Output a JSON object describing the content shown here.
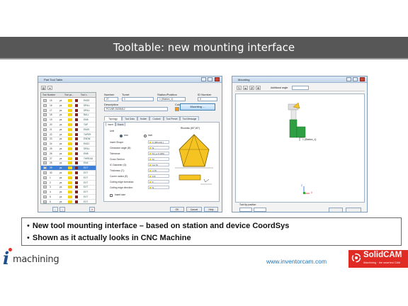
{
  "slide": {
    "title": "Tooltable: new mounting interface",
    "bullets": [
      "New tool mounting interface – based on station and device CoordSys",
      "Shown as it actually looks in CNC Machine"
    ],
    "website": "www.inventorcam.com",
    "logos": {
      "imachining_small": " ",
      "imachining_word": "machining",
      "imachining_i": "i",
      "solidcam": "SolidCAM",
      "solidcam_tagline": "iMachining · the smartest CAM"
    }
  },
  "colors": {
    "title_bar": "#575757",
    "accent_red": "#e02b25",
    "link_blue": "#1d73b7",
    "tool_yellow": "#f5d400",
    "mount_green": "#2ea043"
  },
  "tool_table_window": {
    "title": "Part Tool Table",
    "grid_headers": [
      "Tool Number",
      "Tool po...",
      "Tool t..."
    ],
    "rows": [
      {
        "num": "15",
        "pos": "ps",
        "type": "EM15",
        "sel": false
      },
      {
        "num": "16",
        "pos": "ps",
        "type": "DRILL",
        "sel": false
      },
      {
        "num": "17",
        "pos": "ps",
        "type": "DRILL",
        "sel": false
      },
      {
        "num": "18",
        "pos": "ps",
        "type": "BALL",
        "sel": false
      },
      {
        "num": "19",
        "pos": "ps",
        "type": "EM6",
        "sel": false
      },
      {
        "num": "20",
        "pos": "ps",
        "type": "TAP",
        "sel": false
      },
      {
        "num": "21",
        "pos": "ps",
        "type": "EM20",
        "sel": false
      },
      {
        "num": "22",
        "pos": "ps",
        "type": "TAPER",
        "sel": false
      },
      {
        "num": "23",
        "pos": "ps",
        "type": "ENDM",
        "sel": false
      },
      {
        "num": "24",
        "pos": "ps",
        "type": "EM12",
        "sel": false
      },
      {
        "num": "25",
        "pos": "ps",
        "type": "DRILL",
        "sel": false
      },
      {
        "num": "26",
        "pos": "ps",
        "type": "EM8",
        "sel": false
      },
      {
        "num": "27",
        "pos": "ps",
        "type": "THREAD",
        "sel": false
      },
      {
        "num": "28",
        "pos": "ps",
        "type": "EM4",
        "sel": false
      },
      {
        "num": "29",
        "pos": "ps",
        "type": "EXT",
        "sel": true
      },
      {
        "num": "30",
        "pos": "ps",
        "type": "EXT",
        "sel": false
      },
      {
        "num": "1",
        "pos": "ps",
        "type": "EXT",
        "sel": false
      },
      {
        "num": "2",
        "pos": "ps",
        "type": "EXT",
        "sel": false
      },
      {
        "num": "3",
        "pos": "ps",
        "type": "EXT",
        "sel": false
      },
      {
        "num": "4",
        "pos": "ps",
        "type": "EXT",
        "sel": false
      },
      {
        "num": "5",
        "pos": "ps",
        "type": "EXT",
        "sel": false
      },
      {
        "num": "6",
        "pos": "ps",
        "type": "EXT",
        "sel": false
      }
    ],
    "group_label": "MULTITURRET",
    "labels": {
      "number": "Number",
      "turret": "Turret",
      "station": "Station/Position",
      "id": "ID Number",
      "description": "Description",
      "color": "Color",
      "mounting": "Mounting ..."
    },
    "values": {
      "number": "27",
      "turret": "1",
      "station": "1 (Station_1)",
      "id": "0",
      "description": "PCLNR 2525M12"
    },
    "tabs": [
      "Topology",
      "Tool Data",
      "Holder",
      "Coolant",
      "Tool Preset",
      "Tool Message"
    ],
    "subtabs": [
      "Insert",
      "Shank"
    ],
    "unit_label": "Unit",
    "units": [
      "mm",
      "inch"
    ],
    "preview_title": "Rhombic (80°,80°)",
    "params": [
      {
        "label": "Insert Shape:",
        "value": "C (Rhomb.)"
      },
      {
        "label": "Clearance angle (B):",
        "value": "N"
      },
      {
        "label": "Tolerance:",
        "value": "M (+/-0.025)"
      },
      {
        "label": "Cross Section:",
        "value": "M"
      },
      {
        "label": "IC Diameter (G):",
        "value": "12.70"
      },
      {
        "label": "Thickness (T):",
        "value": "4.76"
      },
      {
        "label": "Corner radius (E):",
        "value": "0.8"
      },
      {
        "label": "Cutting edge formation:",
        "value": "F"
      },
      {
        "label": "Cutting edge direction:",
        "value": "N"
      }
    ],
    "insert_size": "Insert size",
    "footer_buttons": [
      "←",
      "→",
      "✕",
      "OK",
      "Cancel",
      "Help"
    ]
  },
  "mounting_window": {
    "title": "Mounting",
    "label_additional_angle": "Additional angle:",
    "label_tool_position": "Tool tip position",
    "station_label": "1 (Station_1)",
    "axis_labels": [
      "Z",
      "X"
    ]
  }
}
